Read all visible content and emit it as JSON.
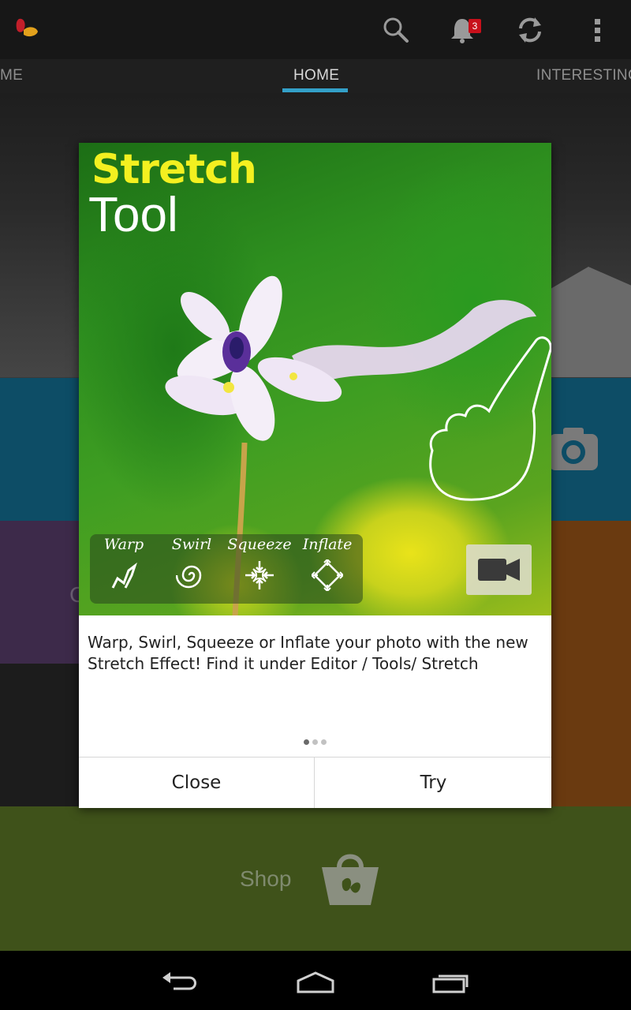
{
  "appbar": {
    "notification_count": "3"
  },
  "tabs": {
    "left_partial": "ME",
    "home": "HOME",
    "interesting": "INTERESTING"
  },
  "background": {
    "shop_label": "Shop",
    "partial_tile_letter": "C"
  },
  "dialog": {
    "title_line1": "Stretch",
    "title_line2": "Tool",
    "tools": [
      {
        "label": "Warp",
        "icon": "warp-icon"
      },
      {
        "label": "Swirl",
        "icon": "swirl-icon"
      },
      {
        "label": "Squeeze",
        "icon": "squeeze-icon"
      },
      {
        "label": "Inflate",
        "icon": "inflate-icon"
      }
    ],
    "description": "Warp, Swirl, Squeeze or Inflate your photo with the new Stretch Effect! Find it under Editor / Tools/ Stretch",
    "page_indicator": {
      "current": 1,
      "total": 3
    },
    "close_label": "Close",
    "try_label": "Try"
  },
  "colors": {
    "accent": "#33a0c8",
    "badge": "#c8101b",
    "title_yellow": "#f3f020"
  }
}
